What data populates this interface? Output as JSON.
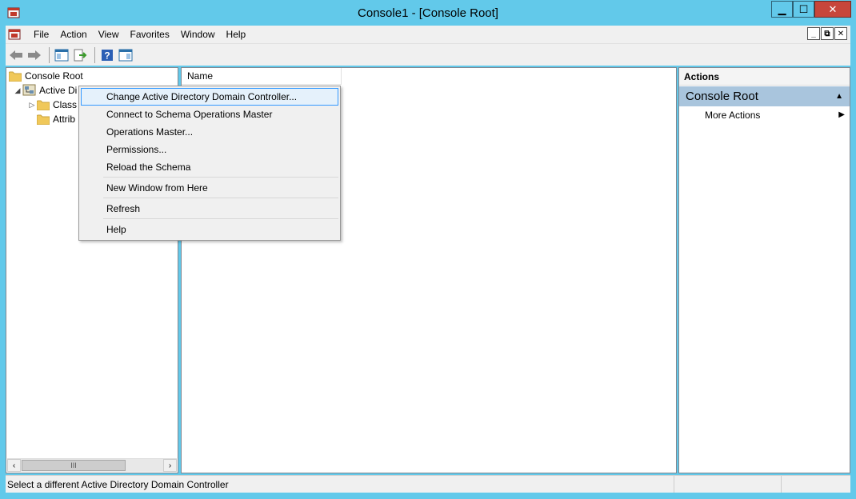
{
  "window": {
    "title": "Console1 - [Console Root]",
    "app_icon": "mmc-console-icon",
    "caption_buttons": {
      "minimize": "▁",
      "maximize": "☐",
      "close": "✕"
    }
  },
  "menubar": {
    "items": [
      "File",
      "Action",
      "View",
      "Favorites",
      "Window",
      "Help"
    ],
    "mdi_buttons": {
      "minimize": "_",
      "restore": "⧉",
      "close": "✕"
    }
  },
  "toolbar": {
    "buttons": [
      "back-icon",
      "forward-icon",
      "show-hide-console-tree-icon",
      "export-list-icon",
      "help-icon",
      "show-hide-action-pane-icon"
    ]
  },
  "tree": {
    "items": [
      {
        "label": "Console Root",
        "icon": "folder-icon",
        "expander": ""
      },
      {
        "label": "Active Di",
        "icon": "schema-icon",
        "expander": "◢"
      },
      {
        "label": "Class",
        "icon": "folder-icon",
        "expander": "▷"
      },
      {
        "label": "Attrib",
        "icon": "folder-icon",
        "expander": ""
      }
    ],
    "scroll_thumb": "III"
  },
  "list": {
    "columns": [
      "Name"
    ]
  },
  "actions": {
    "title": "Actions",
    "group": "Console Root",
    "items": [
      "More Actions"
    ]
  },
  "context_menu": {
    "items": [
      "Change Active Directory Domain Controller...",
      "Connect to Schema Operations Master",
      "Operations Master...",
      "Permissions...",
      "Reload the Schema",
      "New Window from Here",
      "Refresh",
      "Help"
    ],
    "highlighted_index": 0
  },
  "statusbar": {
    "text": "Select a different Active Directory Domain Controller"
  },
  "colors": {
    "frame": "#62c9ea",
    "close_button": "#c7463b",
    "actions_group_bg": "#a9c5dd",
    "menu_highlight_bg": "#e5f1fb",
    "menu_highlight_border": "#3399ff"
  }
}
